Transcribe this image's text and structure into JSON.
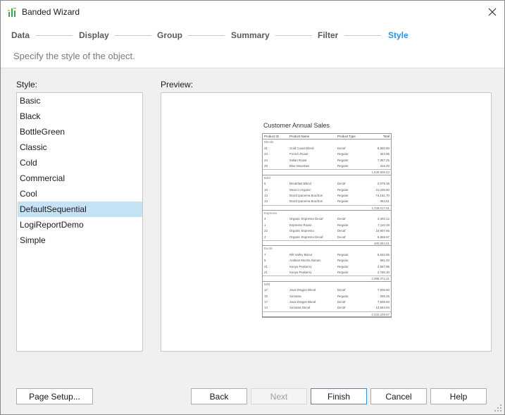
{
  "window": {
    "title": "Banded Wizard"
  },
  "steps": [
    {
      "label": "Data",
      "active": false
    },
    {
      "label": "Display",
      "active": false
    },
    {
      "label": "Group",
      "active": false
    },
    {
      "label": "Summary",
      "active": false
    },
    {
      "label": "Filter",
      "active": false
    },
    {
      "label": "Style",
      "active": true
    }
  ],
  "subtitle": "Specify the style of the object.",
  "style_panel": {
    "label": "Style:",
    "items": [
      "Basic",
      "Black",
      "BottleGreen",
      "Classic",
      "Cold",
      "Commercial",
      "Cool",
      "DefaultSequential",
      "LogiReportDemo",
      "Simple"
    ],
    "selected": "DefaultSequential"
  },
  "preview": {
    "label": "Preview:",
    "report": {
      "title": "Customer Annual Sales",
      "headers": [
        "Product ID",
        "Product Name",
        "Product Type",
        "Total"
      ],
      "groups": [
        {
          "name": "Blends",
          "rows": [
            [
              "31",
              "Gold Coast Blend",
              "Decaf",
              "8,550.60"
            ],
            [
              "23",
              "French Roast",
              "Regular",
              "323.95"
            ],
            [
              "24",
              "Italian Roast",
              "Regular",
              "7,367.25"
            ],
            [
              "29",
              "Blue Mountain",
              "Regular",
              "316.40"
            ]
          ],
          "subtotal": "1,639,506.43"
        },
        {
          "name": "Bold",
          "rows": [
            [
              "6",
              "Breakfast Blend",
              "Decaf",
              "2,079.36"
            ],
            [
              "10",
              "Mexico Organic",
              "Regular",
              "21,035.60"
            ],
            [
              "13",
              "Brazil Ipanema Bourbon",
              "Regular",
              "74,151.70"
            ],
            [
              "13",
              "Brazil Ipanema Bourbon",
              "Regular",
              "384.61"
            ]
          ],
          "subtotal": "1,729,017.01"
        },
        {
          "name": "Espresso",
          "rows": [
            [
              "4",
              "Organic Espresso Decaf",
              "Decaf",
              "3,402.12"
            ],
            [
              "1",
              "Espresso Roast",
              "Regular",
              "7,110.19"
            ],
            [
              "22",
              "Organic Espresso",
              "Decaf",
              "10,907.65"
            ],
            [
              "4",
              "Organic Espresso Decaf",
              "Decaf",
              "8,559.97"
            ]
          ],
          "subtotal": "400,684.61"
        },
        {
          "name": "Exotic",
          "rows": [
            [
              "7",
              "Rift Valley Blend",
              "Regular",
              "8,542.65"
            ],
            [
              "5",
              "Arabian Mocha Sanani",
              "Regular",
              "681.03"
            ],
            [
              "21",
              "Kenya Peaberry",
              "Regular",
              "2,557.95"
            ],
            [
              "21",
              "Kenya Peaberry",
              "Regular",
              "2,780.30"
            ]
          ],
          "subtotal": "2,098,372.41"
        },
        {
          "name": "Mild",
          "rows": [
            [
              "17",
              "Java Dragon Blend",
              "Decaf",
              "7,506.60"
            ],
            [
              "15",
              "Sumatra",
              "Regular",
              "299.25"
            ],
            [
              "17",
              "Java Dragon Blend",
              "Decaf",
              "7,505.60"
            ],
            [
              "14",
              "Sumatra Decaf",
              "Decaf",
              "12,664.94"
            ]
          ],
          "subtotal": "2,334,229.67"
        }
      ]
    }
  },
  "buttons": {
    "page_setup": "Page Setup...",
    "back": "Back",
    "next": "Next",
    "finish": "Finish",
    "cancel": "Cancel",
    "help": "Help"
  },
  "colors": {
    "accent": "#2e90d8",
    "selection": "#c6e2f5"
  }
}
